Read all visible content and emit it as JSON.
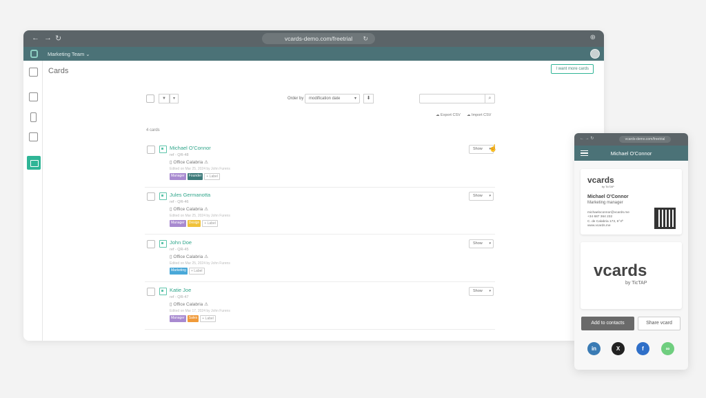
{
  "browser": {
    "url": "vcards-demo.com/freetrial"
  },
  "appbar": {
    "team": "Marketing Team ⌄"
  },
  "page": {
    "title": "Cards",
    "want_more": "I want more cards"
  },
  "toolbar": {
    "filter_icon": "▼",
    "filter_dd": "▾",
    "order_label": "Order by",
    "order_value": "modification date",
    "sort_icon": "⬇",
    "export_csv": "☁ Export CSV",
    "import_csv": "☁ Import CSV"
  },
  "list": {
    "count": "4 cards"
  },
  "rows": [
    {
      "name": "Michael O'Connor",
      "ref": "ref - QR-48",
      "office": "Office Calabria ⚠",
      "edited": "Edited on Mar 25, 2024 by John Furens",
      "tags": [
        "Manager",
        "Founder"
      ],
      "add": "+ Label",
      "show": "Show"
    },
    {
      "name": "Jules Germanotta",
      "ref": "ref - QR-46",
      "office": "Office Calabria ⚠",
      "edited": "Edited on Mar 25, 2024 by John Furens",
      "tags": [
        "Manager",
        "Design"
      ],
      "add": "+ Label",
      "show": "Show"
    },
    {
      "name": "John Doe",
      "ref": "ref - QR-45",
      "office": "Office Calabria ⚠",
      "edited": "Edited on Mar 25, 2024 by John Furens",
      "tags": [
        "Marketing"
      ],
      "add": "+ Label",
      "show": "Show"
    },
    {
      "name": "Katie Joe",
      "ref": "ref - QR-47",
      "office": "Office Calabria ⚠",
      "edited": "Edited on Mar 17, 2024 by John Furens",
      "tags": [
        "Manager",
        "Sales"
      ],
      "add": "+ Label",
      "show": "Show"
    }
  ],
  "tag_colors": {
    "Manager": "#a88ad0",
    "Founder": "#3d7a7a",
    "Design": "#f0c23a",
    "Marketing": "#49a8d8",
    "Sales": "#f09a3a"
  },
  "mobile": {
    "url": "vcards-demo.com/freetrial",
    "title": "Michael O'Connor",
    "logo": "vcards",
    "logo_by": "by TicTAP",
    "name": "Michael O'Connor",
    "role": "Marketing manager",
    "email": "michaeloconnor@vcards.me",
    "phone": "+34 687 364 232",
    "address": "C. de Calabria 173, 6°4ª",
    "web": "www.vcards.me",
    "add_contacts": "Add to contacts",
    "share": "Share vcard",
    "social": [
      "in",
      "X",
      "f",
      "∞"
    ]
  },
  "colors": {
    "accent": "#2fb596",
    "appbar": "#4b7277"
  }
}
